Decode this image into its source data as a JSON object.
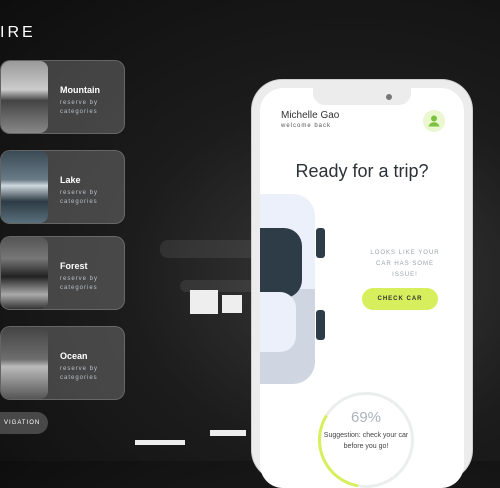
{
  "brand": {
    "text": "IRE"
  },
  "cards": [
    {
      "title": "Mountain",
      "subtitle": "reserve by categories"
    },
    {
      "title": "Lake",
      "subtitle": "reserve by categories"
    },
    {
      "title": "Forest",
      "subtitle": "reserve by categories"
    },
    {
      "title": "Ocean",
      "subtitle": "reserve by categories"
    }
  ],
  "nav": {
    "label": "VIGATION"
  },
  "phone": {
    "user": {
      "name": "Michelle Gao",
      "subtitle": "welcome back"
    },
    "headline": "Ready for a trip?",
    "warning": "LOOKS LIKE YOUR CAR HAS SOME ISSUE!",
    "check_button": "CHECK CAR",
    "gauge": {
      "percent_label": "69%",
      "percent": 69,
      "suggestion": "Suggestion: check your car before you go!"
    }
  },
  "colors": {
    "accent": "#d7ef5c",
    "avatar_icon": "#7cc241",
    "gauge_arc": "#d7ef5c"
  },
  "icons": {
    "avatar": "user-icon"
  }
}
